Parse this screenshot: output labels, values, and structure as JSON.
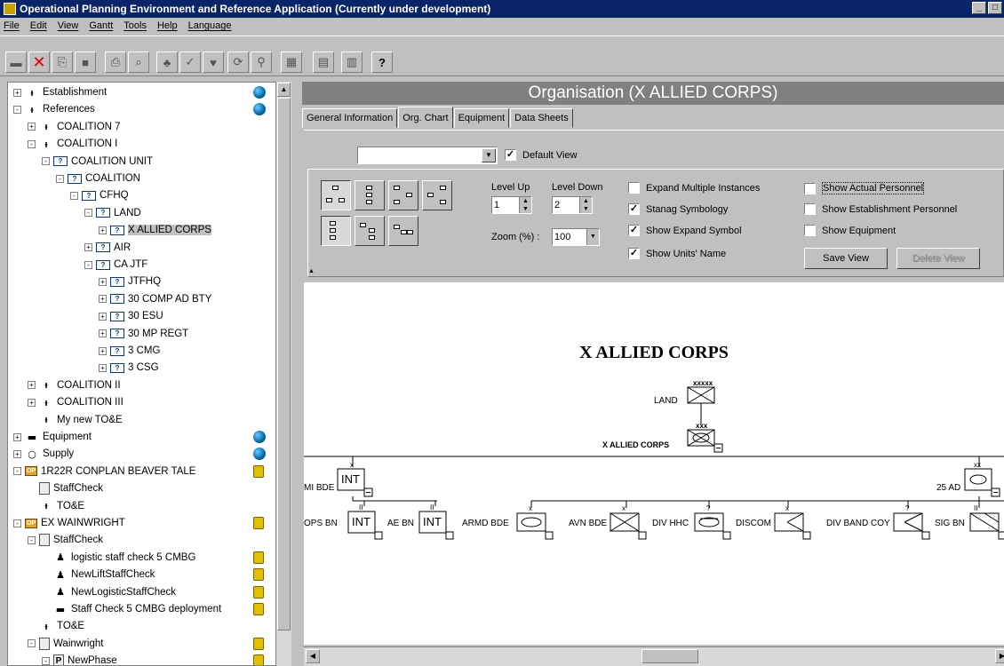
{
  "window": {
    "title": "Operational Planning Environment and Reference Application  (Currently under development)"
  },
  "menu": [
    "File",
    "Edit",
    "View",
    "Gantt",
    "Tools",
    "Help",
    "Language"
  ],
  "tree": [
    {
      "label": "Establishment",
      "level": 0,
      "expand": "+",
      "icon": "t",
      "right": "globe"
    },
    {
      "label": "References",
      "level": 0,
      "expand": "-",
      "icon": "t",
      "right": "globe"
    },
    {
      "label": "COALITION 7",
      "level": 1,
      "expand": "+",
      "icon": "t"
    },
    {
      "label": "COALITION I",
      "level": 1,
      "expand": "-",
      "icon": "t"
    },
    {
      "label": "COALITION UNIT",
      "level": 2,
      "expand": "-",
      "icon": "unit"
    },
    {
      "label": "COALITION",
      "level": 3,
      "expand": "-",
      "icon": "unit"
    },
    {
      "label": "CFHQ",
      "level": 4,
      "expand": "-",
      "icon": "unit"
    },
    {
      "label": "LAND",
      "level": 5,
      "expand": "-",
      "icon": "unit"
    },
    {
      "label": "X ALLIED CORPS",
      "level": 6,
      "expand": "+",
      "icon": "unit",
      "selected": true
    },
    {
      "label": "AIR",
      "level": 5,
      "expand": "+",
      "icon": "unit"
    },
    {
      "label": "CA JTF",
      "level": 5,
      "expand": "-",
      "icon": "unit"
    },
    {
      "label": "JTFHQ",
      "level": 6,
      "expand": "+",
      "icon": "unit"
    },
    {
      "label": "30 COMP AD BTY",
      "level": 6,
      "expand": "+",
      "icon": "unit"
    },
    {
      "label": "30 ESU",
      "level": 6,
      "expand": "+",
      "icon": "unit"
    },
    {
      "label": "30 MP REGT",
      "level": 6,
      "expand": "+",
      "icon": "unit"
    },
    {
      "label": "3 CMG",
      "level": 6,
      "expand": "+",
      "icon": "unit"
    },
    {
      "label": "3 CSG",
      "level": 6,
      "expand": "+",
      "icon": "unit"
    },
    {
      "label": "COALITION II",
      "level": 1,
      "expand": "+",
      "icon": "t"
    },
    {
      "label": "COALITION III",
      "level": 1,
      "expand": "+",
      "icon": "t"
    },
    {
      "label": "My new TO&E",
      "level": 1,
      "expand": "",
      "icon": "t"
    },
    {
      "label": "Equipment",
      "level": 0,
      "expand": "+",
      "icon": "tank",
      "right": "globe"
    },
    {
      "label": "Supply",
      "level": 0,
      "expand": "+",
      "icon": "circle",
      "right": "globe"
    },
    {
      "label": "1R22R CONPLAN BEAVER TALE",
      "level": 0,
      "expand": "-",
      "icon": "op",
      "right": "lock"
    },
    {
      "label": "StaffCheck",
      "level": 1,
      "expand": "",
      "icon": "doc"
    },
    {
      "label": "TO&E",
      "level": 1,
      "expand": "",
      "icon": "t"
    },
    {
      "label": "EX WAINWRIGHT",
      "level": 0,
      "expand": "-",
      "icon": "op",
      "right": "lock"
    },
    {
      "label": "StaffCheck",
      "level": 1,
      "expand": "-",
      "icon": "doc"
    },
    {
      "label": "logistic staff check 5 CMBG",
      "level": 2,
      "expand": "",
      "icon": "person",
      "right": "lock"
    },
    {
      "label": "NewLiftStaffCheck",
      "level": 2,
      "expand": "",
      "icon": "person",
      "right": "lock"
    },
    {
      "label": "NewLogisticStaffCheck",
      "level": 2,
      "expand": "",
      "icon": "person",
      "right": "lock"
    },
    {
      "label": "Staff Check 5 CMBG deployment",
      "level": 2,
      "expand": "",
      "icon": "truck",
      "right": "lock"
    },
    {
      "label": "TO&E",
      "level": 1,
      "expand": "",
      "icon": "t"
    },
    {
      "label": "Wainwright",
      "level": 1,
      "expand": "-",
      "icon": "doc",
      "right": "lock"
    },
    {
      "label": "NewPhase",
      "level": 2,
      "expand": "-",
      "icon": "P",
      "right": "lock"
    }
  ],
  "org": {
    "header": "Organisation (X ALLIED CORPS)",
    "tabs": [
      "General Information",
      "Org. Chart",
      "Equipment",
      "Data Sheets"
    ],
    "active_tab": "Org. Chart",
    "view_combo": "",
    "default_view": "Default View",
    "level_up_label": "Level Up",
    "level_down_label": "Level Down",
    "level_up": "1",
    "level_down": "2",
    "zoom_label": "Zoom (%) :",
    "zoom": "100",
    "options": {
      "expand_multiple": "Expand Multiple Instances",
      "stanag": "Stanag Symbology",
      "expand_symbol": "Show Expand Symbol",
      "units_name": "Show Units' Name",
      "actual_personnel": "Show Actual Personnel",
      "establishment_personnel": "Show Establishment Personnel",
      "equipment": "Show Equipment"
    },
    "save_view": "Save View",
    "delete_view": "Delete View"
  },
  "chart": {
    "title": "X ALLIED CORPS",
    "land": "LAND",
    "corps": "X ALLIED CORPS",
    "mi_bde": "MI BDE",
    "int": "INT",
    "ad25": "25 AD",
    "ops_bn": "OPS BN",
    "ae_bn": "AE BN",
    "armd_bde": "ARMD BDE",
    "avn_bde": "AVN BDE",
    "div_hhc": "DIV HHC",
    "discom": "DISCOM",
    "div_band": "DIV BAND COY",
    "sig_bn": "SIG BN"
  }
}
